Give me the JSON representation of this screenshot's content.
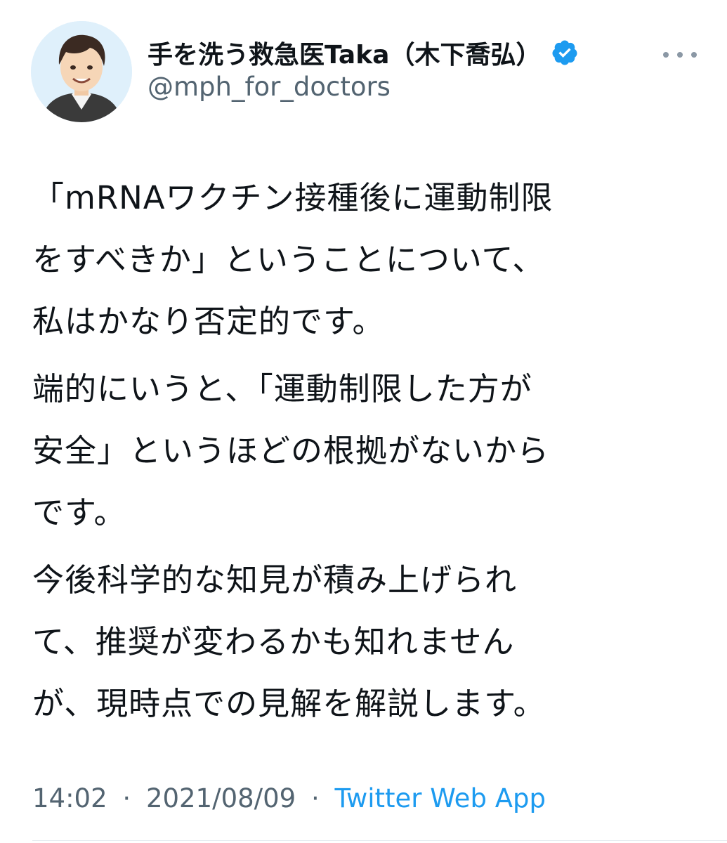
{
  "author": {
    "display_name": "手を洗う救急医Taka（木下喬弘）",
    "handle": "@mph_for_doctors",
    "avatar_icon": "user-avatar",
    "verified_icon": "verified-badge-icon",
    "verified_color": "#1d9bf0"
  },
  "more_icon": "more-options-icon",
  "tweet": {
    "paragraphs": [
      {
        "lines": [
          "「mRNAワクチン接種後に運動制限",
          "をすべきか」ということについて、",
          "私はかなり否定的です。"
        ]
      },
      {
        "lines": [
          "端的にいうと、「運動制限した方が",
          "安全」というほどの根拠がないから",
          "です。"
        ]
      },
      {
        "lines": [
          "今後科学的な知見が積み上げられ",
          "て、推奨が変わるかも知れません",
          "が、現時点での見解を解説します。"
        ]
      }
    ]
  },
  "meta": {
    "time": "14:02",
    "date": "2021/08/09",
    "separator": "·",
    "source": "Twitter Web App",
    "source_color": "#1d9bf0"
  }
}
